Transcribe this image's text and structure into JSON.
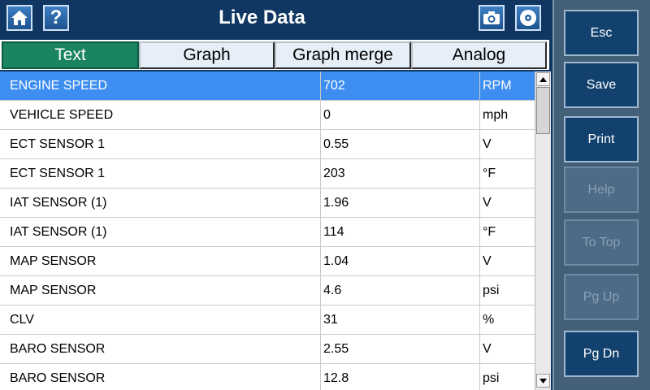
{
  "header": {
    "title": "Live Data",
    "left_buttons": [
      {
        "icon": "home-icon"
      },
      {
        "icon": "help-icon",
        "glyph": "?"
      }
    ],
    "right_buttons": [
      {
        "icon": "camera-icon"
      },
      {
        "icon": "disc-icon"
      }
    ]
  },
  "tabs": [
    {
      "label": "Text",
      "active": true
    },
    {
      "label": "Graph",
      "active": false
    },
    {
      "label": "Graph merge",
      "active": false
    },
    {
      "label": "Analog",
      "active": false
    }
  ],
  "rows": [
    {
      "name": "ENGINE SPEED",
      "value": "702",
      "unit": "RPM",
      "selected": true
    },
    {
      "name": "VEHICLE SPEED",
      "value": "0",
      "unit": "mph"
    },
    {
      "name": "ECT SENSOR 1",
      "value": "0.55",
      "unit": "V"
    },
    {
      "name": "ECT SENSOR 1",
      "value": "203",
      "unit": "°F"
    },
    {
      "name": "IAT SENSOR (1)",
      "value": "1.96",
      "unit": "V"
    },
    {
      "name": "IAT SENSOR (1)",
      "value": "114",
      "unit": "°F"
    },
    {
      "name": "MAP SENSOR",
      "value": "1.04",
      "unit": "V"
    },
    {
      "name": "MAP SENSOR",
      "value": "4.6",
      "unit": "psi"
    },
    {
      "name": "CLV",
      "value": "31",
      "unit": "%"
    },
    {
      "name": "BARO SENSOR",
      "value": "2.55",
      "unit": "V"
    },
    {
      "name": "BARO SENSOR",
      "value": "12.8",
      "unit": "psi"
    }
  ],
  "side_buttons": [
    {
      "label": "Esc",
      "enabled": true
    },
    {
      "label": "Save",
      "enabled": true
    },
    {
      "label": "Print",
      "enabled": true
    },
    {
      "label": "Help",
      "enabled": false
    },
    {
      "label": "To Top",
      "enabled": false
    },
    {
      "label": "Pg Up",
      "enabled": false
    },
    {
      "label": "Pg Dn",
      "enabled": true
    }
  ],
  "colors": {
    "background": "#0f3762",
    "selected_row": "#3d8ef0",
    "active_tab": "#1b8460",
    "side_panel": "#446079",
    "side_button": "#12416d",
    "side_button_disabled": "#4d6a86"
  }
}
